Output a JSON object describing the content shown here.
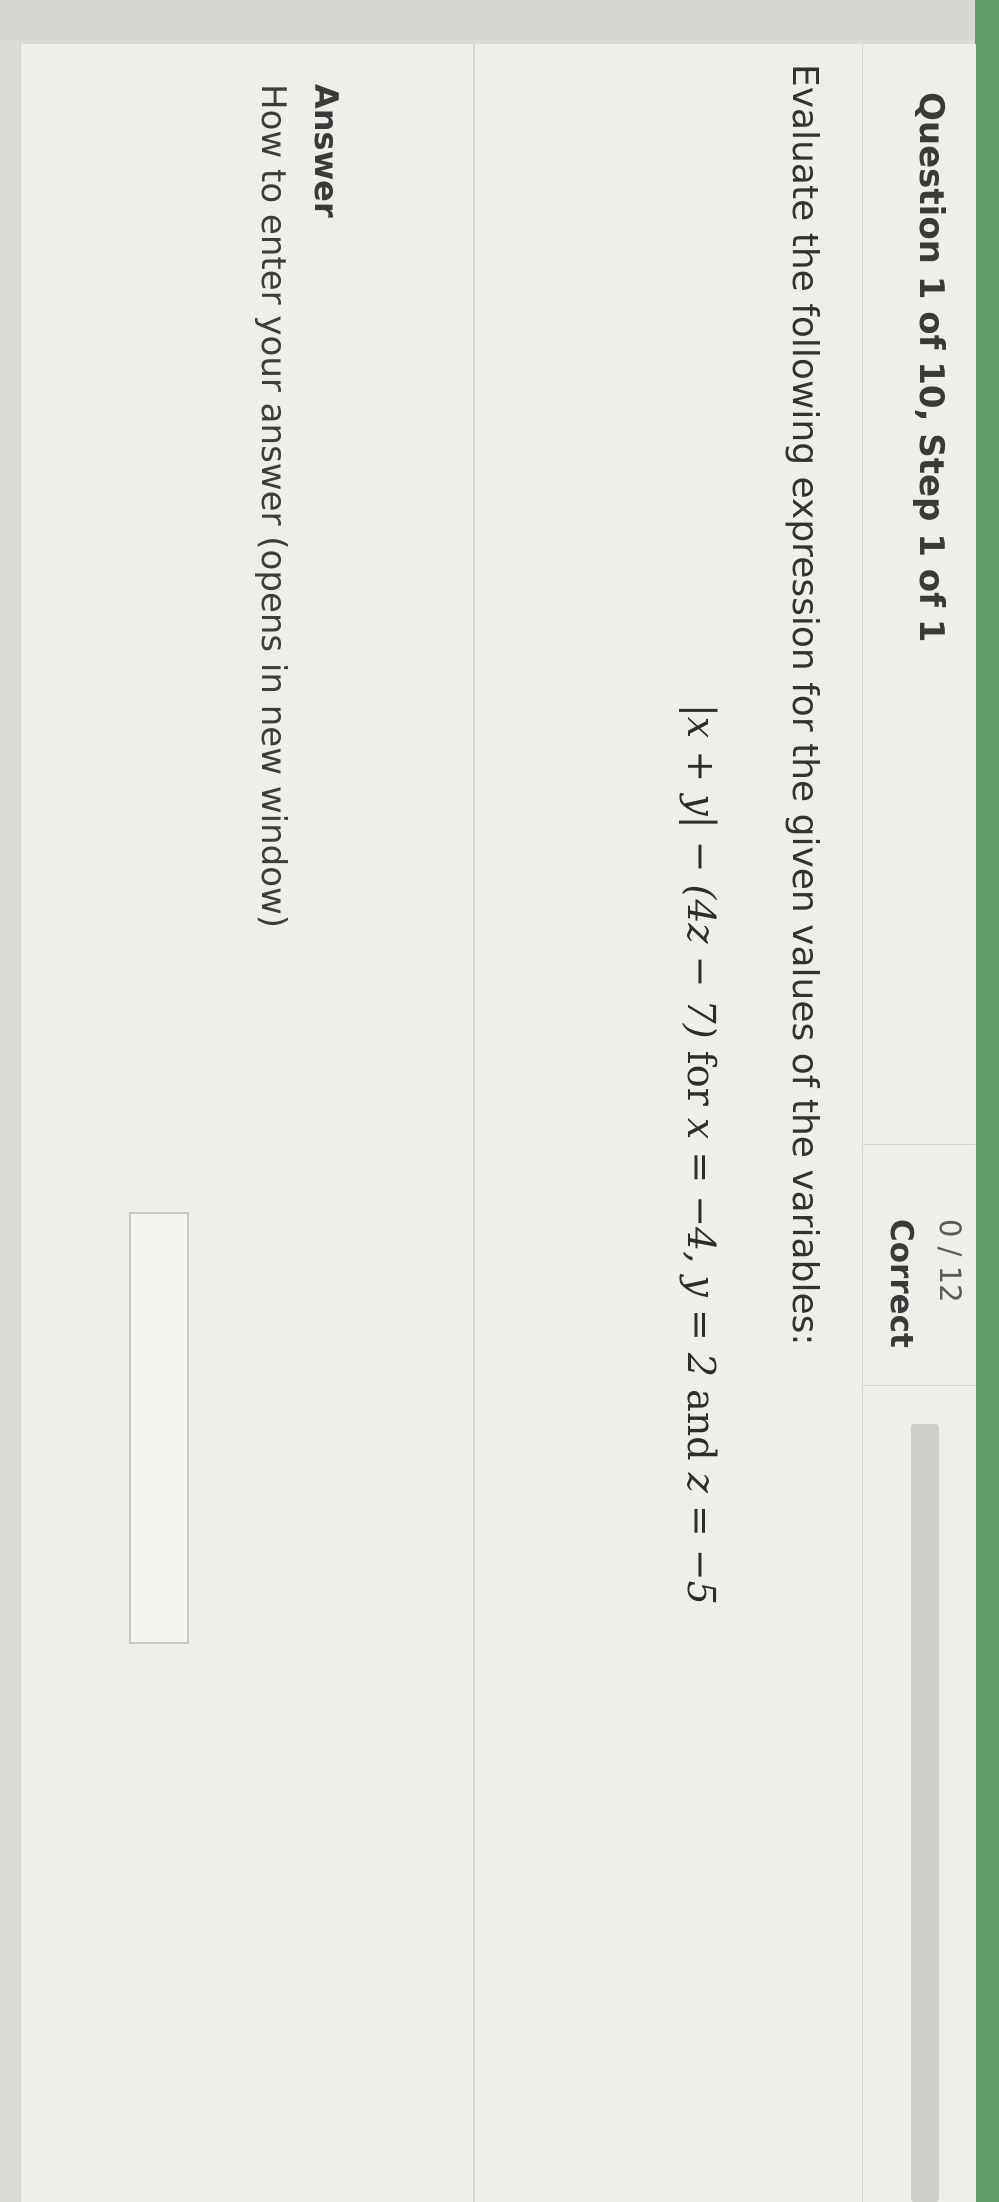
{
  "header": {
    "question_title": "Question 1 of 10, Step 1 of 1",
    "score": "0 / 12",
    "score_label": "Correct",
    "progress_fraction": 0
  },
  "question": {
    "prompt": "Evaluate the following expression for the given values of the variables:",
    "expression": {
      "part1": "|x + y| − (4z − 7)",
      "for_label": "for",
      "part2": "x = −4, y = 2",
      "and_label": "and",
      "part3": "z = −5"
    }
  },
  "answer": {
    "label": "Answer",
    "help_link": "How to enter your answer (opens in new window)",
    "input_value": ""
  },
  "colors": {
    "accent_green": "#5f9e65",
    "background": "#efefea"
  }
}
